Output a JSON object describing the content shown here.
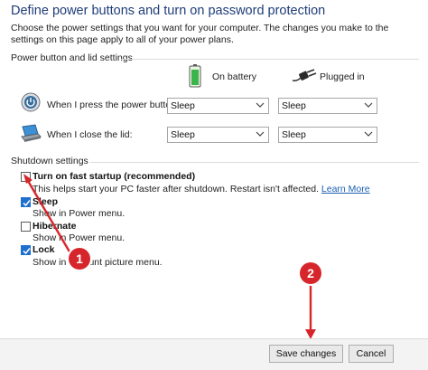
{
  "page": {
    "title": "Define power buttons and turn on password protection",
    "description": "Choose the power settings that you want for your computer. The changes you make to the settings on this page apply to all of your power plans."
  },
  "power_group": {
    "label": "Power button and lid settings",
    "col_battery": "On battery",
    "col_plugged": "Plugged in",
    "rows": [
      {
        "label": "When I press the power button:",
        "battery": "Sleep",
        "plugged": "Sleep"
      },
      {
        "label": "When I close the lid:",
        "battery": "Sleep",
        "plugged": "Sleep"
      }
    ]
  },
  "shutdown_group": {
    "label": "Shutdown settings",
    "options": [
      {
        "label": "Turn on fast startup (recommended)",
        "desc": "This helps start your PC faster after shutdown. Restart isn't affected.",
        "link": "Learn More",
        "checked": false
      },
      {
        "label": "Sleep",
        "desc": "Show in Power menu.",
        "checked": true
      },
      {
        "label": "Hibernate",
        "desc": "Show in Power menu.",
        "checked": false
      },
      {
        "label": "Lock",
        "desc": "Show in account picture menu.",
        "checked": true
      }
    ]
  },
  "annotations": {
    "badge1": "1",
    "badge2": "2",
    "color": "#d6262b"
  },
  "footer": {
    "save_label": "Save changes",
    "cancel_label": "Cancel"
  }
}
